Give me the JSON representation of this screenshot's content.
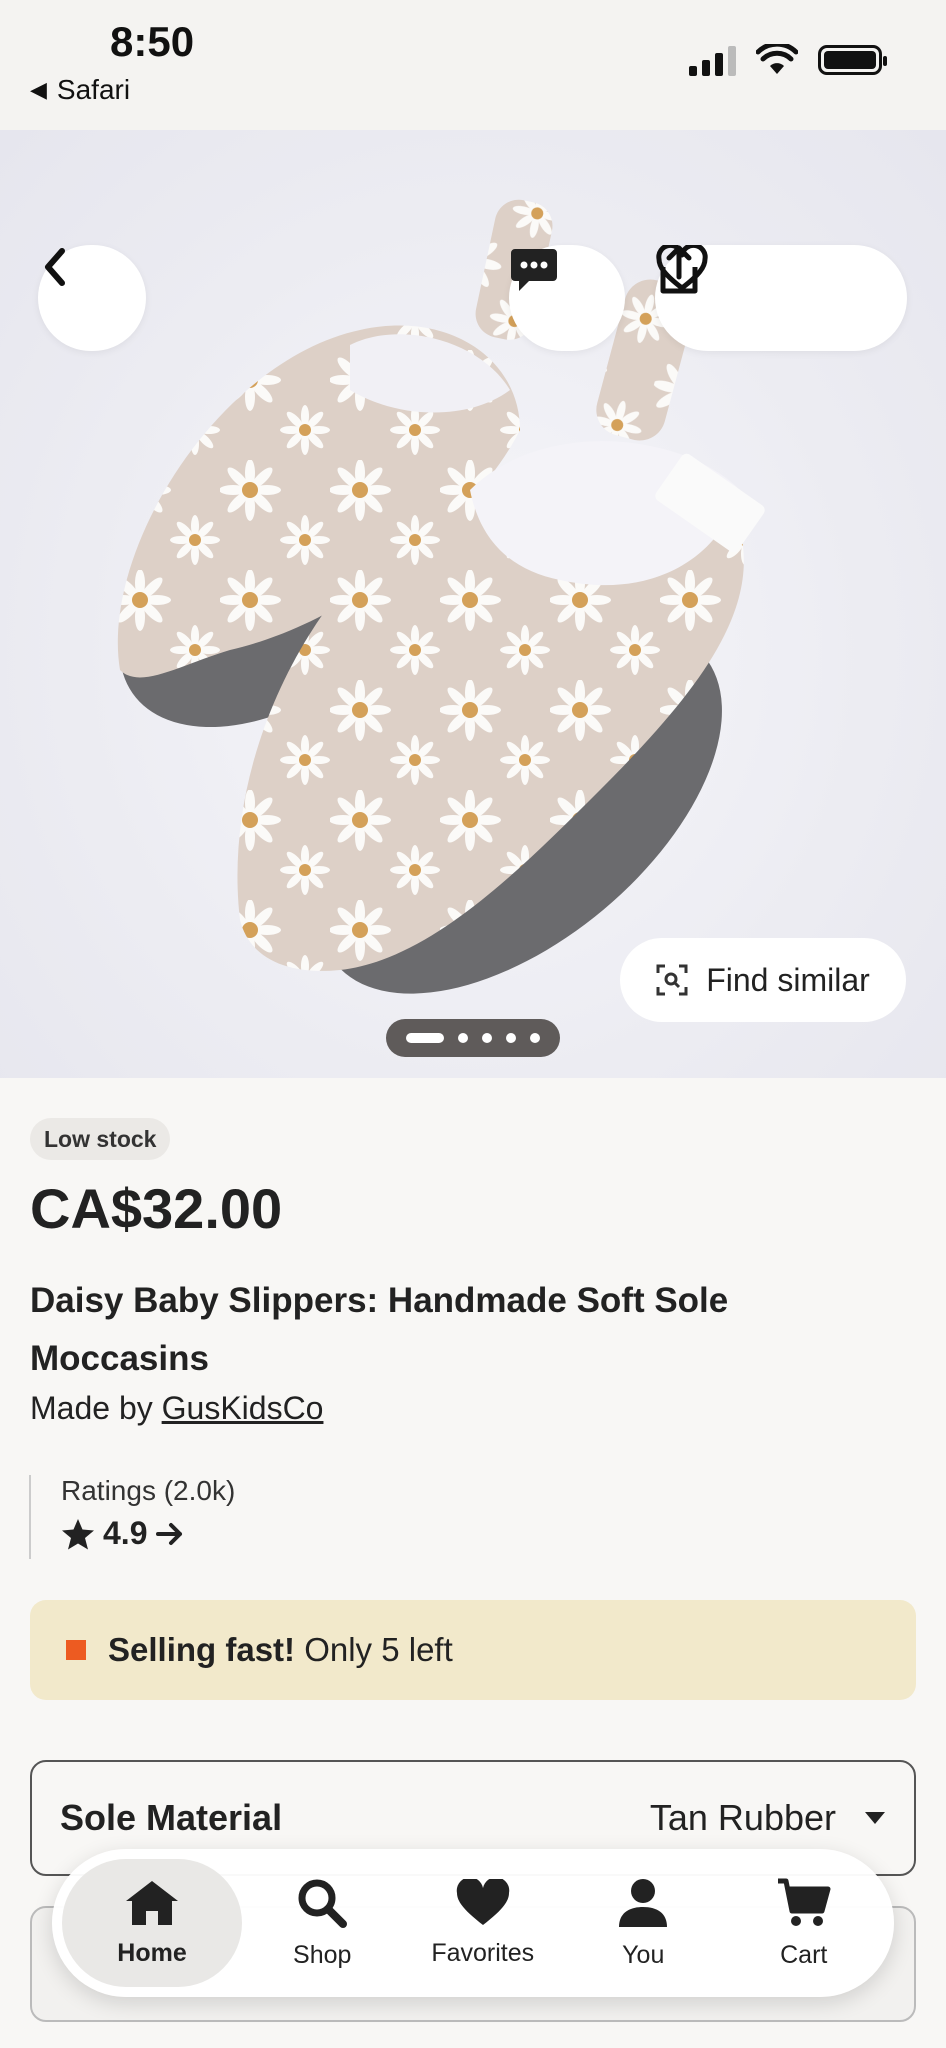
{
  "status_bar": {
    "time": "8:50",
    "back_app": "Safari"
  },
  "hero": {
    "image": "daisy-baby-slippers-photo",
    "find_similar_label": "Find similar",
    "carousel": {
      "total": 5,
      "active_index": 0
    }
  },
  "product": {
    "stock_badge": "Low stock",
    "price": "CA$32.00",
    "title": "Daisy Baby Slippers: Handmade Soft Sole Moccasins",
    "made_by_prefix": "Made by",
    "shop_name": "GusKidsCo",
    "ratings_label": "Ratings (2.0k)",
    "rating_value": "4.9",
    "selling_fast_bold": "Selling fast!",
    "selling_fast_rest": "Only 5 left"
  },
  "variations": {
    "sole_material_label": "Sole Material",
    "sole_material_value": "Tan Rubber"
  },
  "tabbar": {
    "items": [
      {
        "label": "Home",
        "icon": "home-icon",
        "active": true
      },
      {
        "label": "Shop",
        "icon": "search-icon",
        "active": false
      },
      {
        "label": "Favorites",
        "icon": "heart-icon",
        "active": false
      },
      {
        "label": "You",
        "icon": "person-icon",
        "active": false
      },
      {
        "label": "Cart",
        "icon": "cart-icon",
        "active": false
      }
    ]
  },
  "colors": {
    "selling_fast_bg": "#f2e9cb",
    "selling_fast_marker": "#ed5b21",
    "page_bg": "#f8f7f5"
  }
}
